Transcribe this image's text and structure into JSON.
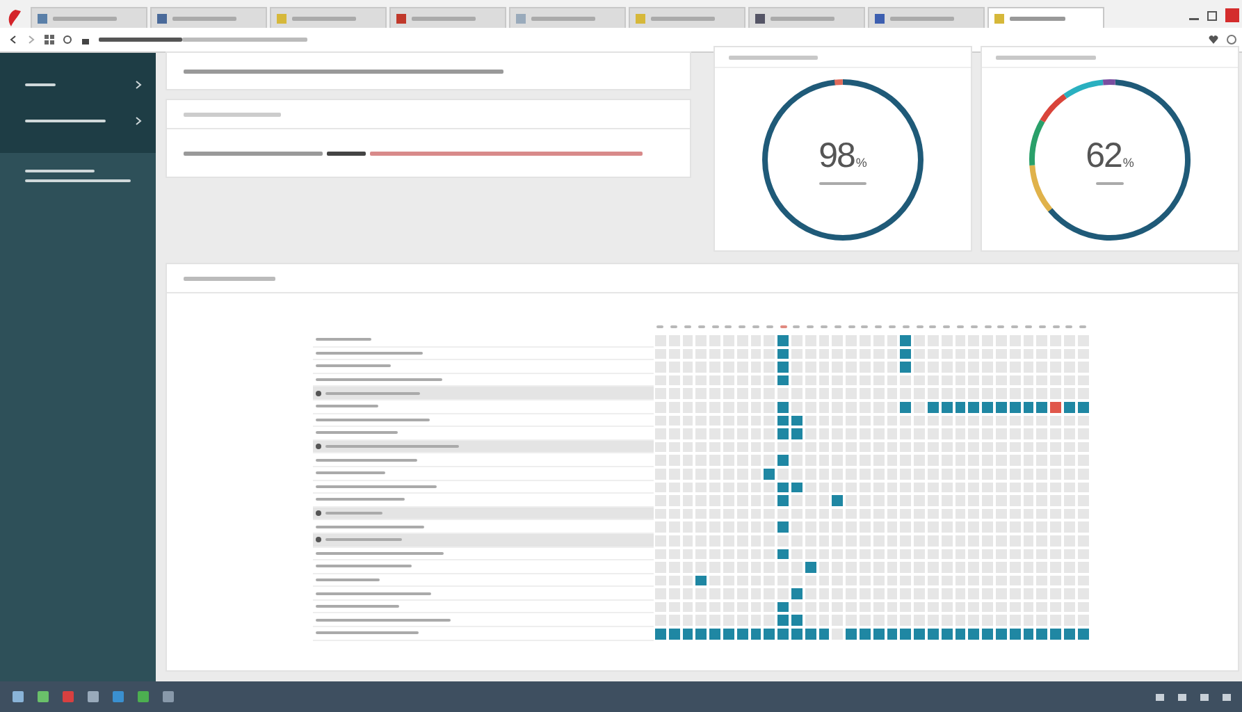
{
  "browser": {
    "tabs": [
      {
        "selected": false
      },
      {
        "selected": false
      },
      {
        "selected": false
      },
      {
        "selected": false
      },
      {
        "selected": false
      },
      {
        "selected": false
      },
      {
        "selected": false
      },
      {
        "selected": false
      },
      {
        "selected": true
      }
    ]
  },
  "gauges": [
    {
      "value": "98",
      "unit": "%"
    },
    {
      "value": "62",
      "unit": "%"
    }
  ],
  "heatmap": {
    "rows": [
      {
        "kind": "item",
        "filled": [
          false,
          false,
          false,
          false,
          false,
          false,
          false,
          false,
          false,
          true,
          false,
          false,
          false,
          false,
          false,
          false,
          false,
          false,
          true,
          false,
          false,
          false,
          false,
          false,
          false,
          false,
          false,
          false,
          false,
          false,
          false,
          false
        ]
      },
      {
        "kind": "item",
        "filled": [
          false,
          false,
          false,
          false,
          false,
          false,
          false,
          false,
          false,
          true,
          false,
          false,
          false,
          false,
          false,
          false,
          false,
          false,
          true,
          false,
          false,
          false,
          false,
          false,
          false,
          false,
          false,
          false,
          false,
          false,
          false,
          false
        ]
      },
      {
        "kind": "item",
        "filled": [
          false,
          false,
          false,
          false,
          false,
          false,
          false,
          false,
          false,
          true,
          false,
          false,
          false,
          false,
          false,
          false,
          false,
          false,
          true,
          false,
          false,
          false,
          false,
          false,
          false,
          false,
          false,
          false,
          false,
          false,
          false,
          false
        ]
      },
      {
        "kind": "item",
        "filled": [
          false,
          false,
          false,
          false,
          false,
          false,
          false,
          false,
          false,
          true,
          false,
          false,
          false,
          false,
          false,
          false,
          false,
          false,
          false,
          false,
          false,
          false,
          false,
          false,
          false,
          false,
          false,
          false,
          false,
          false,
          false,
          false
        ]
      },
      {
        "kind": "group",
        "filled": [
          false,
          false,
          false,
          false,
          false,
          false,
          false,
          false,
          false,
          false,
          false,
          false,
          false,
          false,
          false,
          false,
          false,
          false,
          false,
          false,
          false,
          false,
          false,
          false,
          false,
          false,
          false,
          false,
          false,
          false,
          false,
          false
        ]
      },
      {
        "kind": "item",
        "filled": [
          false,
          false,
          false,
          false,
          false,
          false,
          false,
          false,
          false,
          true,
          false,
          false,
          false,
          false,
          false,
          false,
          false,
          false,
          true,
          false,
          true,
          true,
          true,
          true,
          true,
          true,
          true,
          true,
          true,
          true,
          true,
          true
        ],
        "errors": [
          false,
          false,
          false,
          false,
          false,
          false,
          false,
          false,
          false,
          false,
          false,
          false,
          false,
          false,
          false,
          false,
          false,
          false,
          false,
          false,
          false,
          false,
          false,
          false,
          false,
          false,
          false,
          false,
          false,
          true,
          false,
          false
        ]
      },
      {
        "kind": "item",
        "filled": [
          false,
          false,
          false,
          false,
          false,
          false,
          false,
          false,
          false,
          true,
          true,
          false,
          false,
          false,
          false,
          false,
          false,
          false,
          false,
          false,
          false,
          false,
          false,
          false,
          false,
          false,
          false,
          false,
          false,
          false,
          false,
          false
        ]
      },
      {
        "kind": "item",
        "filled": [
          false,
          false,
          false,
          false,
          false,
          false,
          false,
          false,
          false,
          true,
          true,
          false,
          false,
          false,
          false,
          false,
          false,
          false,
          false,
          false,
          false,
          false,
          false,
          false,
          false,
          false,
          false,
          false,
          false,
          false,
          false,
          false
        ]
      },
      {
        "kind": "group",
        "filled": [
          false,
          false,
          false,
          false,
          false,
          false,
          false,
          false,
          false,
          false,
          false,
          false,
          false,
          false,
          false,
          false,
          false,
          false,
          false,
          false,
          false,
          false,
          false,
          false,
          false,
          false,
          false,
          false,
          false,
          false,
          false,
          false
        ]
      },
      {
        "kind": "item",
        "filled": [
          false,
          false,
          false,
          false,
          false,
          false,
          false,
          false,
          false,
          true,
          false,
          false,
          false,
          false,
          false,
          false,
          false,
          false,
          false,
          false,
          false,
          false,
          false,
          false,
          false,
          false,
          false,
          false,
          false,
          false,
          false,
          false
        ]
      },
      {
        "kind": "item",
        "filled": [
          false,
          false,
          false,
          false,
          false,
          false,
          false,
          false,
          true,
          false,
          false,
          false,
          false,
          false,
          false,
          false,
          false,
          false,
          false,
          false,
          false,
          false,
          false,
          false,
          false,
          false,
          false,
          false,
          false,
          false,
          false,
          false
        ]
      },
      {
        "kind": "item",
        "filled": [
          false,
          false,
          false,
          false,
          false,
          false,
          false,
          false,
          false,
          true,
          true,
          false,
          false,
          false,
          false,
          false,
          false,
          false,
          false,
          false,
          false,
          false,
          false,
          false,
          false,
          false,
          false,
          false,
          false,
          false,
          false,
          false
        ]
      },
      {
        "kind": "item",
        "filled": [
          false,
          false,
          false,
          false,
          false,
          false,
          false,
          false,
          false,
          true,
          false,
          false,
          false,
          true,
          false,
          false,
          false,
          false,
          false,
          false,
          false,
          false,
          false,
          false,
          false,
          false,
          false,
          false,
          false,
          false,
          false,
          false
        ]
      },
      {
        "kind": "group",
        "filled": [
          false,
          false,
          false,
          false,
          false,
          false,
          false,
          false,
          false,
          false,
          false,
          false,
          false,
          false,
          false,
          false,
          false,
          false,
          false,
          false,
          false,
          false,
          false,
          false,
          false,
          false,
          false,
          false,
          false,
          false,
          false,
          false
        ]
      },
      {
        "kind": "item",
        "filled": [
          false,
          false,
          false,
          false,
          false,
          false,
          false,
          false,
          false,
          true,
          false,
          false,
          false,
          false,
          false,
          false,
          false,
          false,
          false,
          false,
          false,
          false,
          false,
          false,
          false,
          false,
          false,
          false,
          false,
          false,
          false,
          false
        ]
      },
      {
        "kind": "group",
        "filled": [
          false,
          false,
          false,
          false,
          false,
          false,
          false,
          false,
          false,
          false,
          false,
          false,
          false,
          false,
          false,
          false,
          false,
          false,
          false,
          false,
          false,
          false,
          false,
          false,
          false,
          false,
          false,
          false,
          false,
          false,
          false,
          false
        ]
      },
      {
        "kind": "item",
        "filled": [
          false,
          false,
          false,
          false,
          false,
          false,
          false,
          false,
          false,
          true,
          false,
          false,
          false,
          false,
          false,
          false,
          false,
          false,
          false,
          false,
          false,
          false,
          false,
          false,
          false,
          false,
          false,
          false,
          false,
          false,
          false,
          false
        ]
      },
      {
        "kind": "item",
        "filled": [
          false,
          false,
          false,
          false,
          false,
          false,
          false,
          false,
          false,
          false,
          false,
          true,
          false,
          false,
          false,
          false,
          false,
          false,
          false,
          false,
          false,
          false,
          false,
          false,
          false,
          false,
          false,
          false,
          false,
          false,
          false,
          false
        ]
      },
      {
        "kind": "item",
        "filled": [
          false,
          false,
          false,
          true,
          false,
          false,
          false,
          false,
          false,
          false,
          false,
          false,
          false,
          false,
          false,
          false,
          false,
          false,
          false,
          false,
          false,
          false,
          false,
          false,
          false,
          false,
          false,
          false,
          false,
          false,
          false,
          false
        ]
      },
      {
        "kind": "item",
        "filled": [
          false,
          false,
          false,
          false,
          false,
          false,
          false,
          false,
          false,
          false,
          true,
          false,
          false,
          false,
          false,
          false,
          false,
          false,
          false,
          false,
          false,
          false,
          false,
          false,
          false,
          false,
          false,
          false,
          false,
          false,
          false,
          false
        ]
      },
      {
        "kind": "item",
        "filled": [
          false,
          false,
          false,
          false,
          false,
          false,
          false,
          false,
          false,
          true,
          false,
          false,
          false,
          false,
          false,
          false,
          false,
          false,
          false,
          false,
          false,
          false,
          false,
          false,
          false,
          false,
          false,
          false,
          false,
          false,
          false,
          false
        ]
      },
      {
        "kind": "item",
        "filled": [
          false,
          false,
          false,
          false,
          false,
          false,
          false,
          false,
          false,
          true,
          true,
          false,
          false,
          false,
          false,
          false,
          false,
          false,
          false,
          false,
          false,
          false,
          false,
          false,
          false,
          false,
          false,
          false,
          false,
          false,
          false,
          false
        ]
      },
      {
        "kind": "item",
        "filled": [
          true,
          true,
          true,
          true,
          true,
          true,
          true,
          true,
          true,
          true,
          true,
          true,
          true,
          false,
          true,
          true,
          true,
          true,
          true,
          true,
          true,
          true,
          true,
          true,
          true,
          true,
          true,
          true,
          true,
          true,
          true,
          true
        ]
      }
    ]
  }
}
